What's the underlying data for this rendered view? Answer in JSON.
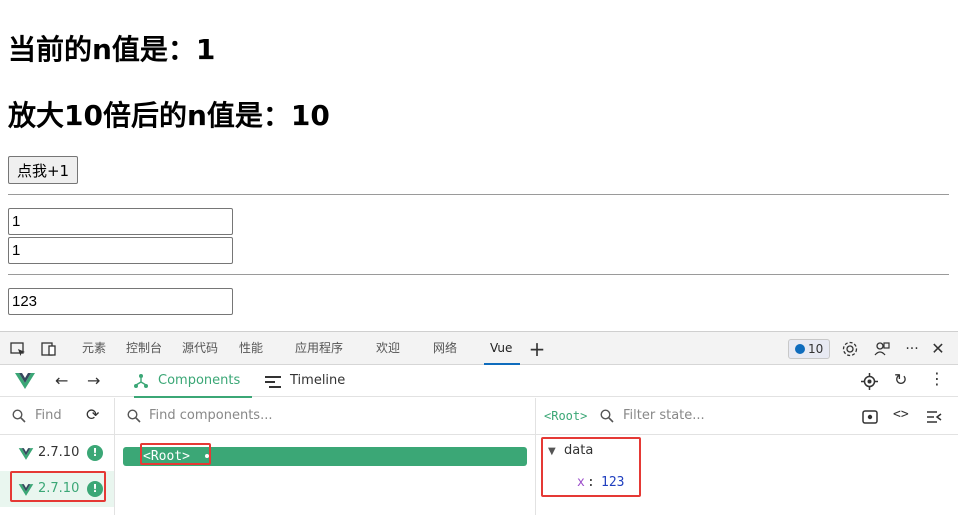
{
  "page": {
    "current_label": "当前的n值是：1",
    "magnified_label": "放大10倍后的n值是：10",
    "button_label": "点我+1",
    "input1_value": "1",
    "input2_value": "1",
    "input3_value": "123"
  },
  "devtools": {
    "tabs": [
      "元素",
      "控制台",
      "源代码",
      "性能",
      "应用程序",
      "欢迎",
      "网络",
      "Vue"
    ],
    "active_tab": "Vue",
    "issues_count": "10"
  },
  "vue": {
    "tabs": {
      "components": "Components",
      "timeline": "Timeline"
    },
    "find_placeholder": "Find",
    "versions": [
      "2.7.10",
      "2.7.10"
    ],
    "find_components_placeholder": "Find components...",
    "root_component": "<Root>",
    "state_component": "<Root>",
    "filter_state_placeholder": "Filter state...",
    "state_section": "data",
    "state_key": "x",
    "state_value": "123"
  },
  "colors": {
    "vue_green": "#3ba776",
    "highlight_red": "#e53935",
    "edge_blue": "#0f6cbd"
  },
  "icons": [
    "inspect-icon",
    "device-icon",
    "add-tab-icon",
    "settings-icon",
    "people-icon",
    "more-icon",
    "close-icon",
    "vue-logo-icon",
    "back-arrow-icon",
    "forward-arrow-icon",
    "components-icon",
    "timeline-icon",
    "target-icon",
    "refresh-icon",
    "menu-dots-icon",
    "search-icon",
    "sync-icon",
    "eye-icon",
    "code-icon",
    "collapse-icon",
    "warning-icon",
    "caret-down-icon"
  ]
}
